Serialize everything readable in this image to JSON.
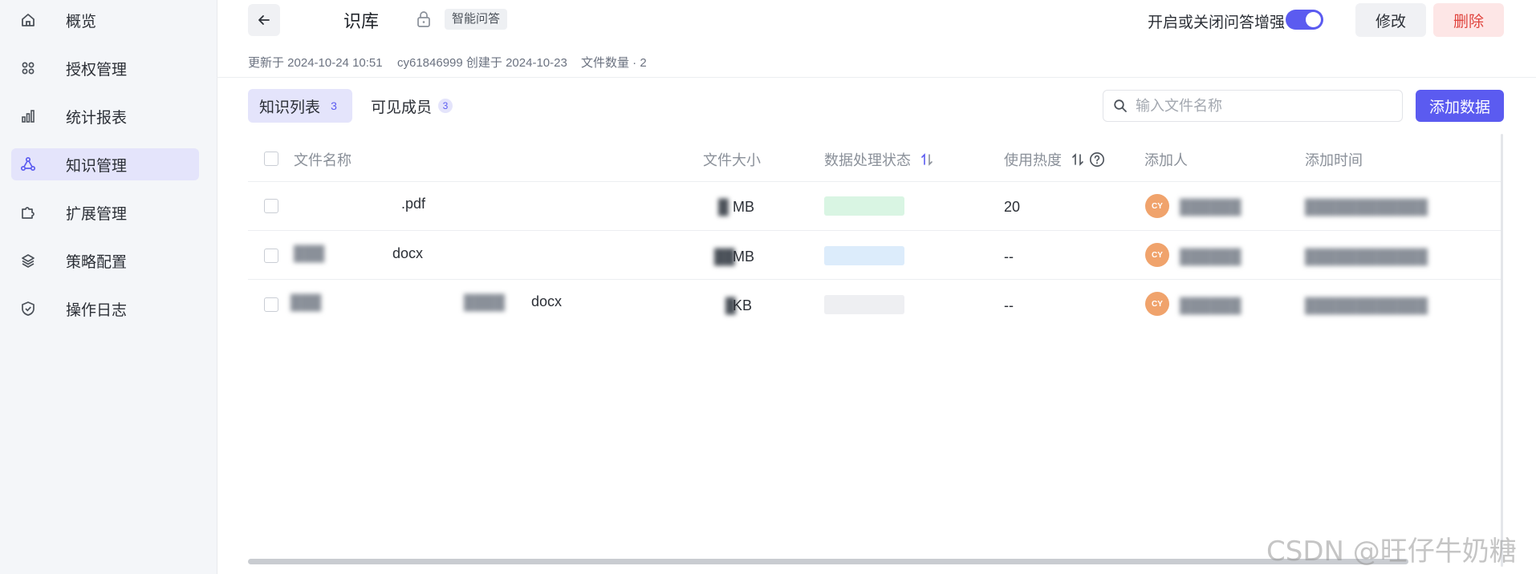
{
  "sidebar": {
    "items": [
      {
        "label": "概览",
        "icon": "home-icon"
      },
      {
        "label": "授权管理",
        "icon": "grid-icon"
      },
      {
        "label": "统计报表",
        "icon": "bar-chart-icon"
      },
      {
        "label": "知识管理",
        "icon": "nodes-icon",
        "active": true
      },
      {
        "label": "扩展管理",
        "icon": "puzzle-icon"
      },
      {
        "label": "策略配置",
        "icon": "layers-icon"
      },
      {
        "label": "操作日志",
        "icon": "shield-check-icon"
      }
    ]
  },
  "header": {
    "title": "识库",
    "tag": "智能问答",
    "updated": "更新于 2024-10-24 10:51",
    "created": "cy61846999 创建于 2024-10-23",
    "file_count": "文件数量 · 2",
    "toggle_label": "开启或关闭问答增强",
    "toggle_on": true,
    "edit_label": "修改",
    "delete_label": "删除"
  },
  "tabs": [
    {
      "label": "知识列表",
      "count": "3",
      "active": true
    },
    {
      "label": "可见成员",
      "count": "3",
      "active": false
    }
  ],
  "search": {
    "placeholder": "输入文件名称"
  },
  "add_label": "添加数据",
  "table": {
    "columns": [
      "文件名称",
      "文件大小",
      "数据处理状态",
      "使用热度",
      "添加人",
      "添加时间"
    ],
    "rows": [
      {
        "name": ".pdf",
        "size": "MB",
        "heat": "20",
        "avatar": "CY",
        "status_color": "#d9f5e3"
      },
      {
        "name": "docx",
        "size": "MB",
        "heat": "--",
        "avatar": "CY",
        "status_color": "#dcecfb"
      },
      {
        "name": "docx",
        "size": "KB",
        "heat": "--",
        "avatar": "CY",
        "status_color": "#eeeff2"
      }
    ]
  },
  "colors": {
    "accent": "#5b5bf0",
    "danger": "#e0443e",
    "avatar": "#f0a36c"
  },
  "watermark": "CSDN @旺仔牛奶糖"
}
